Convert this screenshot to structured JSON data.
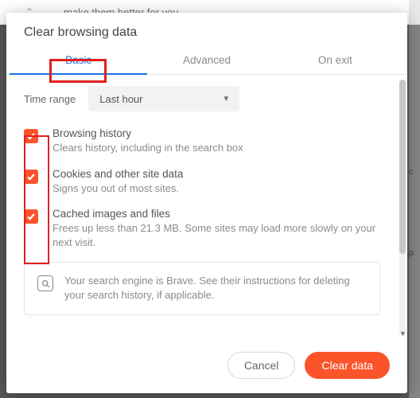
{
  "background": {
    "partial_text": "make them better for you.",
    "right_letters": [
      "c",
      "p"
    ]
  },
  "dialog": {
    "title": "Clear browsing data",
    "tabs": [
      {
        "label": "Basic",
        "active": true
      },
      {
        "label": "Advanced",
        "active": false
      },
      {
        "label": "On exit",
        "active": false
      }
    ],
    "time_range": {
      "label": "Time range",
      "selected": "Last hour"
    },
    "options": [
      {
        "checked": true,
        "title": "Browsing history",
        "desc": "Clears history, including in the search box"
      },
      {
        "checked": true,
        "title": "Cookies and other site data",
        "desc": "Signs you out of most sites."
      },
      {
        "checked": true,
        "title": "Cached images and files",
        "desc": "Frees up less than 21.3 MB. Some sites may load more slowly on your next visit."
      }
    ],
    "info": "Your search engine is Brave. See their instructions for deleting your search history, if applicable.",
    "buttons": {
      "cancel": "Cancel",
      "confirm": "Clear data"
    }
  }
}
